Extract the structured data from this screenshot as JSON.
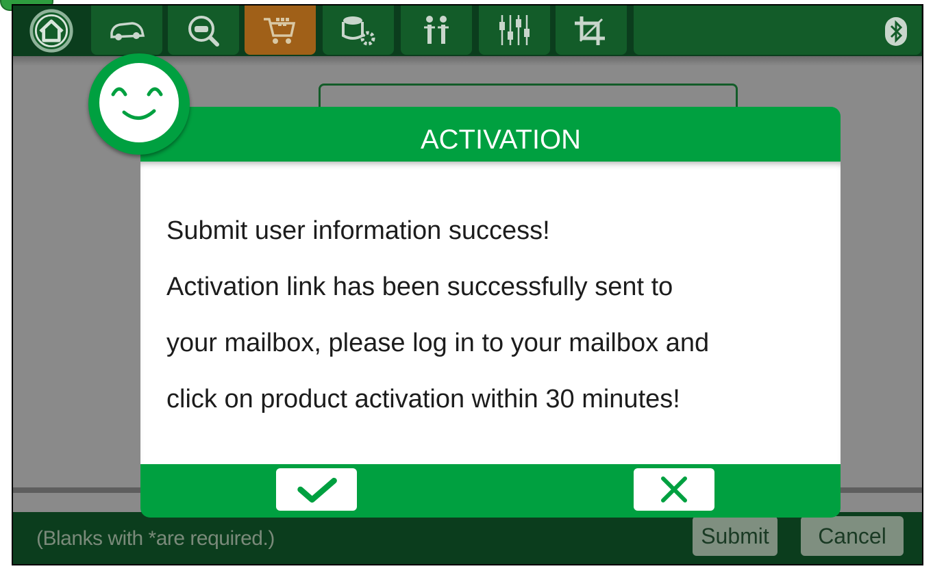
{
  "toolbar": {
    "items": [
      {
        "icon": "home-icon"
      },
      {
        "icon": "car-icon"
      },
      {
        "icon": "car-search-icon"
      },
      {
        "icon": "shopping-cart-icon",
        "active": true
      },
      {
        "icon": "database-settings-icon"
      },
      {
        "icon": "users-icon"
      },
      {
        "icon": "sliders-icon"
      },
      {
        "icon": "crop-icon"
      }
    ],
    "status_icon": "bluetooth-icon"
  },
  "dialog": {
    "title": "ACTIVATION",
    "message_lines": [
      "Submit user information success!",
      "Activation link has been successfully sent to",
      "your mailbox, please log in to your mailbox and",
      "click on product activation within 30 minutes!"
    ],
    "confirm_icon": "checkmark-icon",
    "cancel_icon": "close-icon"
  },
  "form": {
    "hint": "(Blanks with *are required.)",
    "submit_label": "Submit",
    "cancel_label": "Cancel"
  },
  "colors": {
    "accent_green": "#00a040",
    "toolbar_dark": "#0b3d1d",
    "active_tab": "#a06018"
  }
}
